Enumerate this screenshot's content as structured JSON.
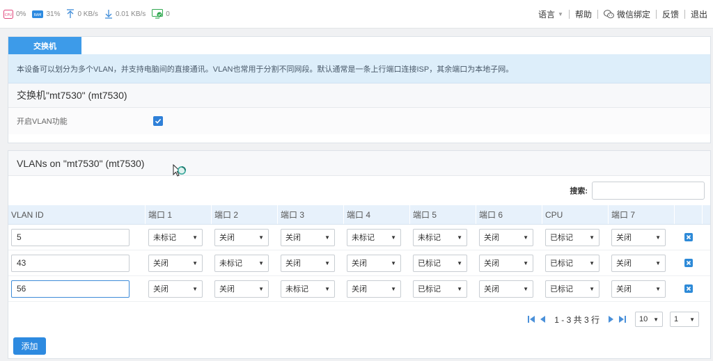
{
  "topbar": {
    "cpu": "0%",
    "ram": "31%",
    "upload": "0 KB/s",
    "download": "0.01 KB/s",
    "devices": "0",
    "language": "语言",
    "help": "帮助",
    "wechat": "微信绑定",
    "feedback": "反馈",
    "logout": "退出"
  },
  "panel1": {
    "tab": "交换机",
    "description": "本设备可以划分为多个VLAN，并支持电脑间的直接通讯。VLAN也常用于分割不同网段。默认通常是一条上行端口连接ISP，其余端口为本地子网。",
    "title": "交换机\"mt7530\" (mt7530)",
    "vlan_enable_label": "开启VLAN功能",
    "vlan_enabled": true
  },
  "panel2": {
    "title": "VLANs on \"mt7530\" (mt7530)",
    "search_label": "搜索:",
    "search_value": "",
    "columns": [
      "VLAN ID",
      "端口 1",
      "端口 2",
      "端口 3",
      "端口 4",
      "端口 5",
      "端口 6",
      "CPU",
      "端口 7"
    ],
    "rows": [
      {
        "id": "5",
        "ports": [
          "未标记",
          "关闭",
          "关闭",
          "未标记",
          "未标记",
          "关闭",
          "已标记",
          "关闭"
        ]
      },
      {
        "id": "43",
        "ports": [
          "关闭",
          "未标记",
          "关闭",
          "关闭",
          "已标记",
          "关闭",
          "已标记",
          "关闭"
        ]
      },
      {
        "id": "56",
        "ports": [
          "关闭",
          "关闭",
          "未标记",
          "关闭",
          "已标记",
          "关闭",
          "已标记",
          "关闭"
        ]
      }
    ],
    "pagination": {
      "summary": "1 - 3 共 3 行",
      "page_size": "10",
      "page": "1"
    },
    "add_label": "添加"
  },
  "colors": {
    "accent": "#3d9be9",
    "primary_button": "#2d8ae0",
    "delete_icon": "#2d8ad8",
    "checkbox": "#2f80d8",
    "info_bg": "#ddeefa",
    "header_bg": "#e7f1fb"
  }
}
